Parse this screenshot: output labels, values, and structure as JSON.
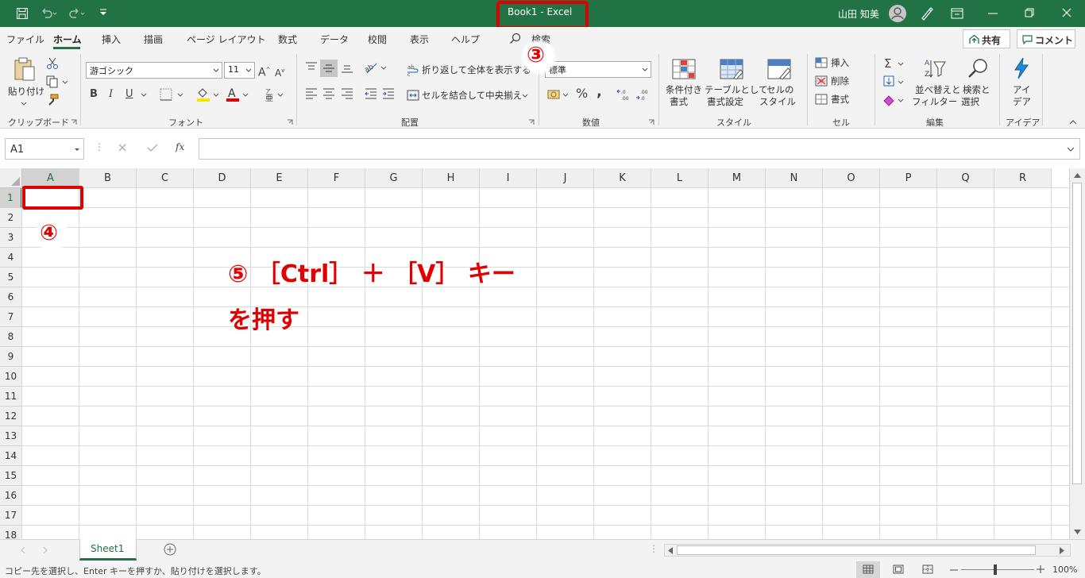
{
  "titlebar": {
    "title": "Book1 - Excel",
    "user": "山田 知美"
  },
  "tabs": [
    "ファイル",
    "ホーム",
    "挿入",
    "描画",
    "ページ レイアウト",
    "数式",
    "データ",
    "校閲",
    "表示",
    "ヘルプ"
  ],
  "search": "検索",
  "share": "共有",
  "comment": "コメント",
  "ribbon": {
    "paste": "貼り付け",
    "clipboard_group": "クリップボード",
    "font_name": "游ゴシック",
    "font_size": "11",
    "font_group": "フォント",
    "wrap": "折り返して全体を表示する",
    "merge": "セルを結合して中央揃え",
    "align_group": "配置",
    "number_format": "標準",
    "number_group": "数値",
    "cond_format": "条件付き",
    "cond_format2": "書式",
    "table_format": "テーブルとして",
    "table_format2": "書式設定",
    "cell_style": "セルの",
    "cell_style2": "スタイル",
    "style_group": "スタイル",
    "insert": "挿入",
    "delete": "削除",
    "format": "書式",
    "cells_group": "セル",
    "sort": "並べ替えと",
    "sort2": "フィルター",
    "find": "検索と",
    "find2": "選択",
    "edit_group": "編集",
    "ideas": "アイ",
    "ideas2": "デア",
    "ideas_group": "アイデア"
  },
  "formula": {
    "namebox": "A1",
    "fx": "fx",
    "content": ""
  },
  "columns": [
    "A",
    "B",
    "C",
    "D",
    "E",
    "F",
    "G",
    "H",
    "I",
    "J",
    "K",
    "L",
    "M",
    "N",
    "O",
    "P",
    "Q",
    "R"
  ],
  "rows": [
    "1",
    "2",
    "3",
    "4",
    "5",
    "6",
    "7",
    "8",
    "9",
    "10",
    "11",
    "12",
    "13",
    "14",
    "15",
    "16",
    "17",
    "18"
  ],
  "sheet": {
    "name": "Sheet1"
  },
  "status": {
    "message": "コピー先を選択し、Enter キーを押すか、貼り付けを選択します。",
    "zoom": "100%"
  },
  "annotations": {
    "step3": "③",
    "step4": "④",
    "step5_line1": "⑤ ［Ctrl］ ＋ ［V］ キー",
    "step5_line2": "を押す"
  },
  "colors": {
    "excel_green": "#217346",
    "annotation_red": "#e00000"
  }
}
